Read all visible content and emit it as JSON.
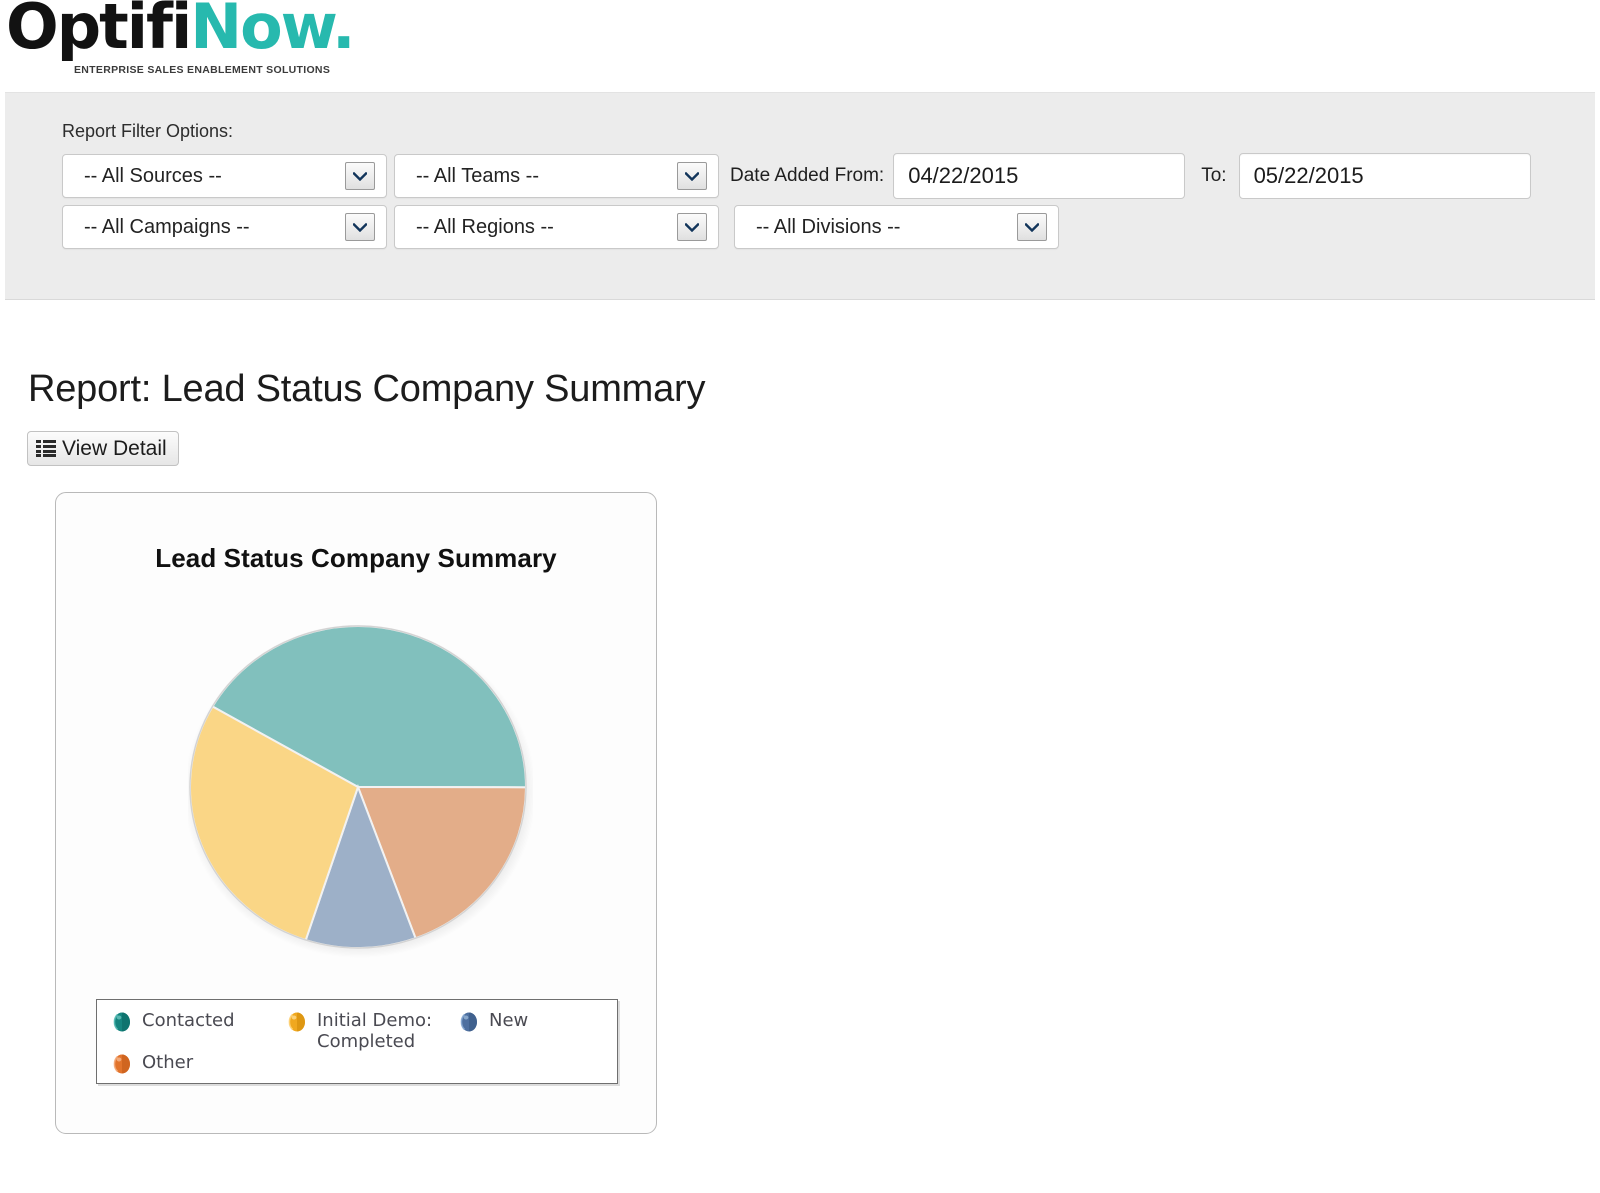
{
  "brand": {
    "name_part1": "Optifi",
    "name_part2": "Now",
    "name_dot": ".",
    "tagline": "ENTERPRISE SALES ENABLEMENT SOLUTIONS",
    "accent_color": "#27b9ae",
    "logo_icon": "optifinow-logo"
  },
  "filters": {
    "heading": "Report Filter Options:",
    "selects": [
      {
        "name": "sources",
        "value": "-- All Sources --"
      },
      {
        "name": "teams",
        "value": "-- All Teams --"
      },
      {
        "name": "campaigns",
        "value": "-- All Campaigns --"
      },
      {
        "name": "regions",
        "value": "-- All Regions --"
      },
      {
        "name": "divisions",
        "value": "-- All Divisions --"
      }
    ],
    "date_from_label": "Date Added From:",
    "date_from_value": "04/22/2015",
    "date_to_label": "To:",
    "date_to_value": "05/22/2015"
  },
  "report": {
    "title": "Report: Lead Status Company Summary",
    "view_detail_label": "View Detail",
    "view_detail_icon": "list-icon"
  },
  "chart_data": {
    "type": "pie",
    "title": "Lead Status Company Summary",
    "categories": [
      "Contacted",
      "Other",
      "New",
      "Initial Demo: Completed"
    ],
    "values": [
      41.7,
      19.4,
      10.6,
      28.3
    ],
    "colors": [
      "#81c0bd",
      "#e3ad89",
      "#9db0c8",
      "#fad686"
    ],
    "legend_colors": [
      "#178a85",
      "#e07b3a",
      "#4f6f9e",
      "#e8a033"
    ],
    "legend_position": "bottom",
    "legend_entries": [
      {
        "label": "Contacted",
        "marker": "sphere-teal"
      },
      {
        "label": "Initial Demo: Completed",
        "marker": "sphere-gold"
      },
      {
        "label": "New",
        "marker": "sphere-blue"
      },
      {
        "label": "Other",
        "marker": "sphere-orange"
      }
    ],
    "start_angle_deg": 300,
    "xlabel": "",
    "ylabel": "",
    "grid": false
  }
}
